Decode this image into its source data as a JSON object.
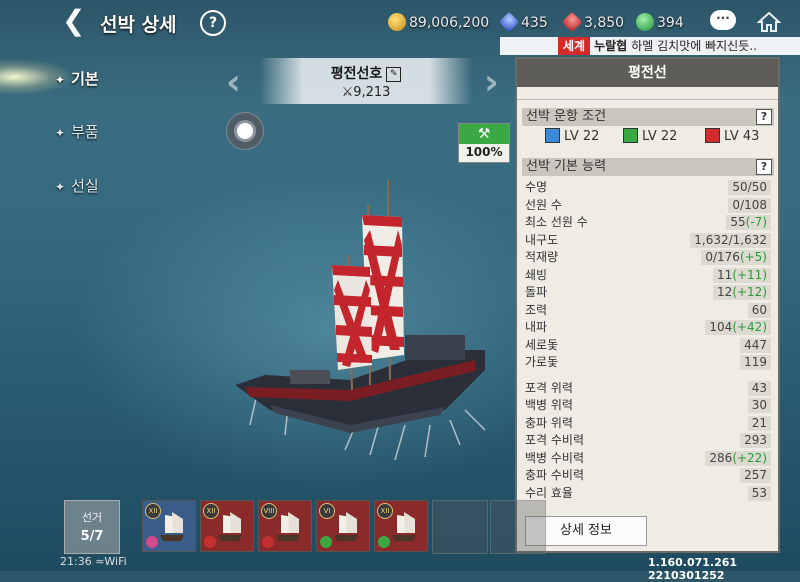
{
  "header": {
    "title": "선박 상세",
    "help": "?",
    "currencies": [
      {
        "icon": "gold-coin-icon",
        "value": "89,006,200"
      },
      {
        "icon": "sapphire-icon",
        "value": "435"
      },
      {
        "icon": "ruby-icon",
        "value": "3,850"
      },
      {
        "icon": "emerald-icon",
        "value": "394"
      }
    ]
  },
  "ticker": {
    "tag": "세계",
    "sender": "누랄협",
    "message": "하멜 김치맛에 빠지신듯.."
  },
  "tabs": [
    {
      "label": "기본",
      "active": true
    },
    {
      "label": "부품",
      "active": false
    },
    {
      "label": "선실",
      "active": false
    }
  ],
  "ship": {
    "name": "평전선호",
    "power": "9,213",
    "durability": "100%"
  },
  "panel": {
    "title": "평전선",
    "req_title": "선박 운항 조건",
    "requirements": [
      {
        "icon": "adventure-level-icon",
        "color": "#3b88d6",
        "label": "LV 22"
      },
      {
        "icon": "trade-level-icon",
        "color": "#3aa843",
        "label": "LV 22"
      },
      {
        "icon": "battle-level-icon",
        "color": "#d12c2c",
        "label": "LV 43"
      }
    ],
    "stats_title": "선박 기본 능력",
    "stats": [
      {
        "label": "수명",
        "value": "50/50",
        "bonus": ""
      },
      {
        "label": "선원 수",
        "value": "0/108",
        "bonus": ""
      },
      {
        "label": "최소 선원 수",
        "value": "55",
        "bonus": "(-7)"
      },
      {
        "label": "내구도",
        "value": "1,632/1,632",
        "bonus": ""
      },
      {
        "label": "적재량",
        "value": "0/176",
        "bonus": "(+5)"
      },
      {
        "label": "쇄빙",
        "value": "11",
        "bonus": "(+11)"
      },
      {
        "label": "돌파",
        "value": "12",
        "bonus": "(+12)"
      },
      {
        "label": "조력",
        "value": "60",
        "bonus": ""
      },
      {
        "label": "내파",
        "value": "104",
        "bonus": "(+42)"
      },
      {
        "label": "세로돛",
        "value": "447",
        "bonus": ""
      },
      {
        "label": "가로돛",
        "value": "119",
        "bonus": ""
      },
      {
        "label": "포격 위력",
        "value": "43",
        "bonus": ""
      },
      {
        "label": "백병 위력",
        "value": "30",
        "bonus": ""
      },
      {
        "label": "충파 위력",
        "value": "21",
        "bonus": ""
      },
      {
        "label": "포격 수비력",
        "value": "293",
        "bonus": ""
      },
      {
        "label": "백병 수비력",
        "value": "286",
        "bonus": "(+22)"
      },
      {
        "label": "충파 수비력",
        "value": "257",
        "bonus": ""
      },
      {
        "label": "수리 효율",
        "value": "53",
        "bonus": ""
      }
    ],
    "detail_button": "상세 정보"
  },
  "fleet": {
    "label": "선거",
    "count": "5/7"
  },
  "slots": [
    {
      "rank": "XII",
      "bg": "#3a5d8a",
      "badge": "#d34a8a"
    },
    {
      "rank": "XII",
      "bg": "#8a2a2a",
      "badge": "#c23030"
    },
    {
      "rank": "VIII",
      "bg": "#8a2a2a",
      "badge": "#c23030"
    },
    {
      "rank": "VI",
      "bg": "#8a2a2a",
      "badge": "#3aa843"
    },
    {
      "rank": "XII",
      "bg": "#8a2a2a",
      "badge": "#3aa843"
    }
  ],
  "status": {
    "time": "21:36",
    "wifi": "WiFi"
  },
  "version": "1.160.071.261 2210301252"
}
